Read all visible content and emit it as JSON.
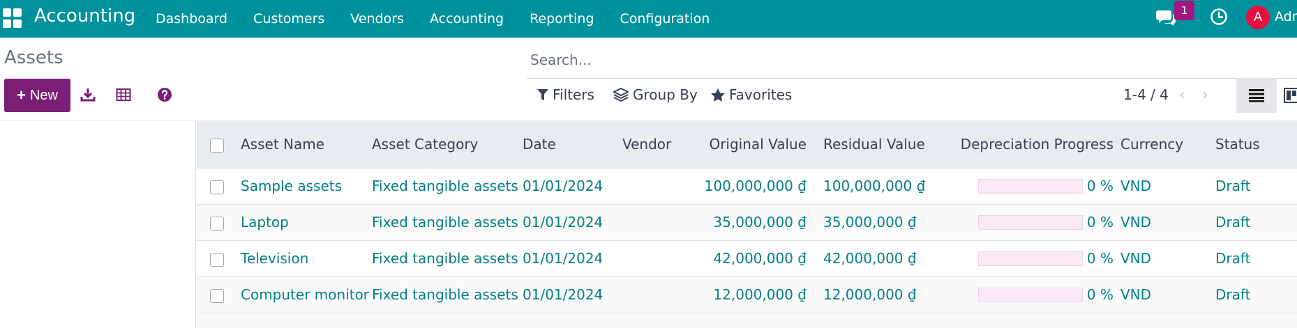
{
  "app": {
    "title": "Accounting"
  },
  "navbar": {
    "menu": [
      {
        "label": "Dashboard"
      },
      {
        "label": "Customers"
      },
      {
        "label": "Vendors"
      },
      {
        "label": "Accounting"
      },
      {
        "label": "Reporting"
      },
      {
        "label": "Configuration"
      }
    ],
    "notification_count": "1",
    "avatar_letter": "A",
    "user_name": "Administrator"
  },
  "control_panel": {
    "breadcrumb": "Assets",
    "new_label": "New",
    "search_placeholder": "Search...",
    "filters_label": "Filters",
    "group_by_label": "Group By",
    "favorites_label": "Favorites",
    "pager": "1-4 / 4"
  },
  "table": {
    "headers": {
      "asset_name": "Asset Name",
      "asset_category": "Asset Category",
      "date": "Date",
      "vendor": "Vendor",
      "original_value": "Original Value",
      "residual_value": "Residual Value",
      "depreciation_progress": "Depreciation Progress",
      "currency": "Currency",
      "status": "Status"
    },
    "rows": [
      {
        "asset_name": "Sample assets",
        "asset_category": "Fixed tangible assets",
        "date": "01/01/2024",
        "vendor": "",
        "original_value": "100,000,000 ₫",
        "residual_value": "100,000,000 ₫",
        "progress": 0,
        "progress_text": "0 %",
        "currency": "VND",
        "status": "Draft"
      },
      {
        "asset_name": "Laptop",
        "asset_category": "Fixed tangible assets",
        "date": "01/01/2024",
        "vendor": "",
        "original_value": "35,000,000 ₫",
        "residual_value": "35,000,000 ₫",
        "progress": 0,
        "progress_text": "0 %",
        "currency": "VND",
        "status": "Draft"
      },
      {
        "asset_name": "Television",
        "asset_category": "Fixed tangible assets",
        "date": "01/01/2024",
        "vendor": "",
        "original_value": "42,000,000 ₫",
        "residual_value": "42,000,000 ₫",
        "progress": 0,
        "progress_text": "0 %",
        "currency": "VND",
        "status": "Draft"
      },
      {
        "asset_name": "Computer monitor",
        "asset_category": "Fixed tangible assets",
        "date": "01/01/2024",
        "vendor": "",
        "original_value": "12,000,000 ₫",
        "residual_value": "12,000,000 ₫",
        "progress": 0,
        "progress_text": "0 %",
        "currency": "VND",
        "status": "Draft"
      }
    ]
  },
  "colors": {
    "navbar": "#00929c",
    "primary_button": "#7a1f75",
    "link": "#017e84",
    "badge": "#a2177f",
    "avatar": "#e6103f"
  },
  "icons": {
    "apps": "apps-grid-icon",
    "chat": "chat-icon",
    "clock": "clock-icon",
    "download": "download-icon",
    "spreadsheet": "spreadsheet-icon",
    "help": "help-icon",
    "filter": "filter-icon",
    "group_by": "layers-icon",
    "favorites": "star-icon",
    "list_view": "list-view-icon",
    "kanban_view": "kanban-view-icon"
  }
}
